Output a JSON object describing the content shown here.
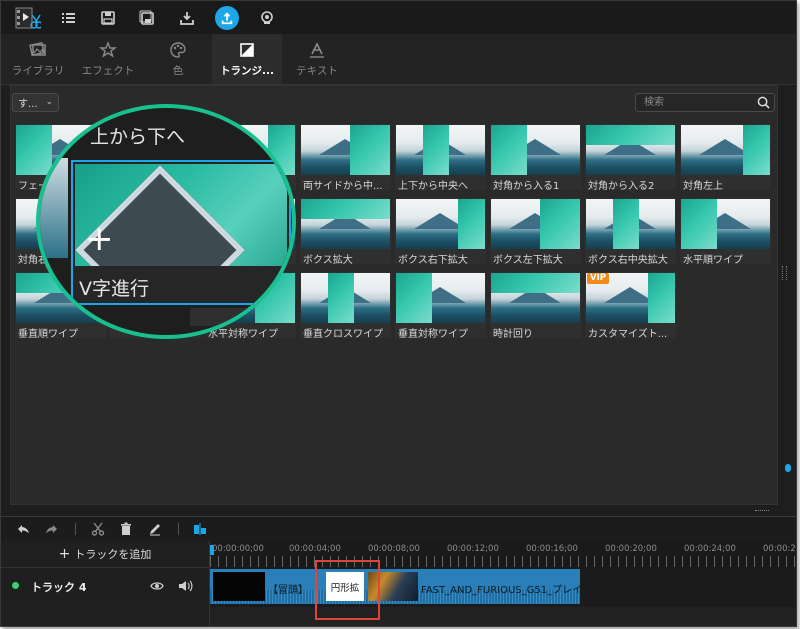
{
  "toolbar": {
    "icons": [
      "logo",
      "list-icon",
      "save-icon",
      "save-as-icon",
      "download-icon",
      "upload-icon",
      "camera-icon"
    ]
  },
  "tabs": [
    {
      "label": "ライブラリ",
      "icon": "library-icon"
    },
    {
      "label": "エフェクト",
      "icon": "effects-icon"
    },
    {
      "label": "色",
      "icon": "palette-icon"
    },
    {
      "label": "トランジ...",
      "icon": "transition-icon",
      "active": true
    },
    {
      "label": "テキスト",
      "icon": "text-icon"
    }
  ],
  "filter": {
    "selected": "す..."
  },
  "search": {
    "placeholder": "検索"
  },
  "transitions": [
    {
      "label": "フェー"
    },
    {
      "label": ""
    },
    {
      "label": "へ"
    },
    {
      "label": "両サイドから中..."
    },
    {
      "label": "上下から中央へ"
    },
    {
      "label": "対角から入る1"
    },
    {
      "label": "対角から入る2"
    },
    {
      "label": "対角左上"
    },
    {
      "label": "対角右"
    },
    {
      "label": ""
    },
    {
      "label": ""
    },
    {
      "label": "ボクス拡大"
    },
    {
      "label": "ボクス右下拡大"
    },
    {
      "label": "ボクス左下拡大"
    },
    {
      "label": "ボクス右中央拡大"
    },
    {
      "label": "水平順ワイプ"
    },
    {
      "label": "垂直順ワイプ"
    },
    {
      "label": ""
    },
    {
      "label": "水平対称ワイプ"
    },
    {
      "label": "垂直クロスワイプ"
    },
    {
      "label": "垂直対称ワイプ"
    },
    {
      "label": "時計回り"
    },
    {
      "label": "カスタマイズト..."
    }
  ],
  "vip_badge": "VIP",
  "magnifier": {
    "above_label": "上から下へ",
    "label": "V字進行"
  },
  "timeline": {
    "add_track": "トラックを追加",
    "track_name": "トラック 4",
    "ruler": [
      "00:00:00;00",
      "00:00:04;00",
      "00:00:08;00",
      "00:00:12;00",
      "00:00:16;00",
      "00:00:20;00",
      "00:00:24;00",
      "00:00:2"
    ],
    "clip1_text": "【冒頭】",
    "transition_text": "円形拡",
    "clip2_text": "FAST_AND_FURIOUS_G51_プレイ"
  },
  "colors": {
    "accent": "#1ea7e8",
    "highlight_red": "#e0453a",
    "magnifier_ring": "#19c08f",
    "track_dot": "#3bd16f",
    "vip": "#f08a1c"
  }
}
